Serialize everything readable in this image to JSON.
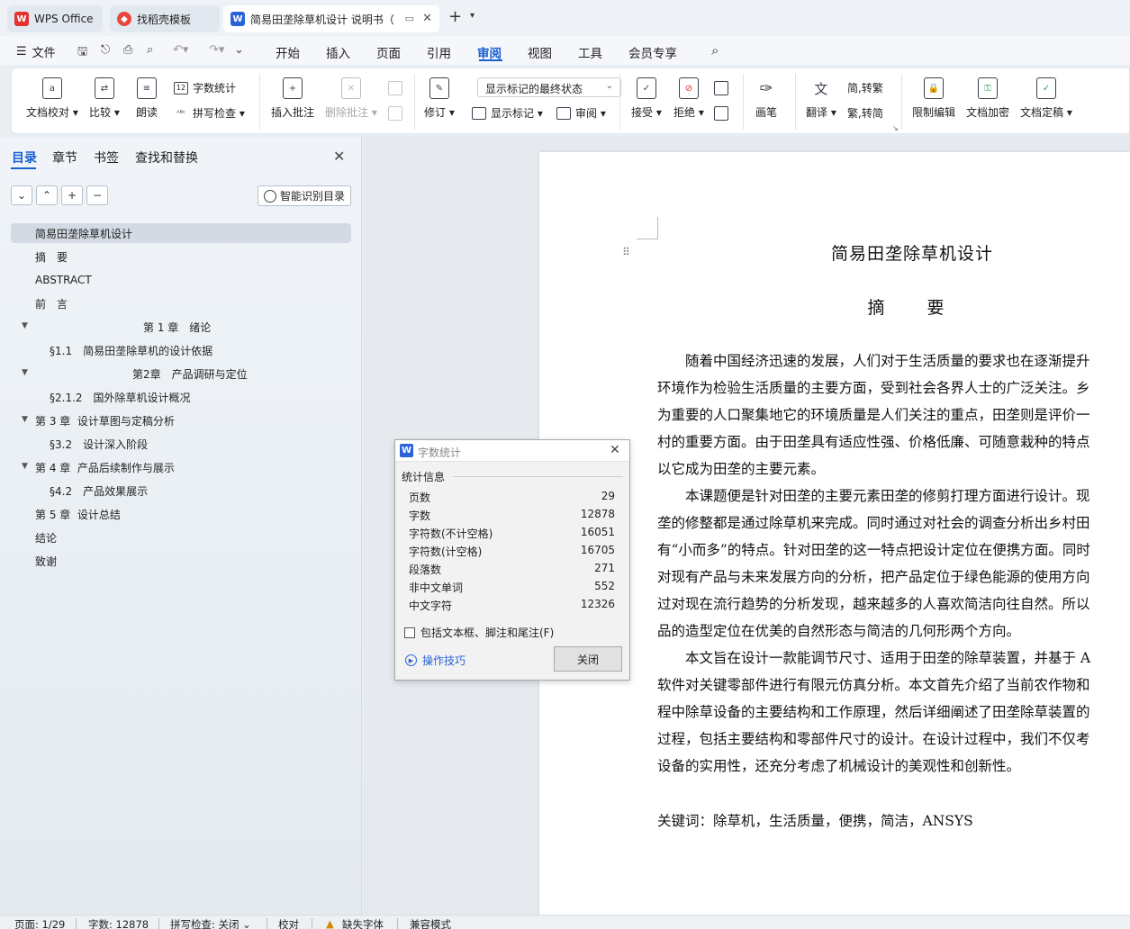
{
  "tabs": {
    "wps": "WPS Office",
    "templates": "找稻壳模板",
    "document": "简易田垄除草机设计 说明书（"
  },
  "menubar": {
    "file": "文件",
    "items": [
      "开始",
      "插入",
      "页面",
      "引用",
      "审阅",
      "视图",
      "工具",
      "会员专享"
    ],
    "active": "审阅"
  },
  "ribbon": {
    "proofread": "文档校对",
    "compare": "比较",
    "read_aloud": "朗读",
    "word_count": "字数统计",
    "spell_check": "拼写检查",
    "insert_comment": "插入批注",
    "delete_comment": "删除批注",
    "track_changes": "修订",
    "markup_state": "显示标记的最终状态",
    "show_markup": "显示标记",
    "review_pane": "审阅",
    "accept": "接受",
    "reject": "拒绝",
    "ink": "画笔",
    "translate": "翻译",
    "to_traditional": "简,转繁",
    "to_simplified": "繁,转简",
    "restrict_editing": "限制编辑",
    "encrypt": "文档加密",
    "finalize": "文档定稿"
  },
  "panel": {
    "tabs": [
      "目录",
      "章节",
      "书签",
      "查找和替换"
    ],
    "active_tab": "目录",
    "smart_toc": "智能识别目录",
    "toc": [
      {
        "label": "简易田垄除草机设计"
      },
      {
        "label": "摘　要"
      },
      {
        "label": "ABSTRACT"
      },
      {
        "label": "前　言"
      },
      {
        "label": "第 1 章　绪论"
      },
      {
        "label": "§1.1　简易田垄除草机的设计依据"
      },
      {
        "label": "第2章　产品调研与定位"
      },
      {
        "label": "§2.1.2　国外除草机设计概况"
      },
      {
        "label": "第 3 章  设计草图与定稿分析"
      },
      {
        "label": "§3.2　设计深入阶段"
      },
      {
        "label": "第 4 章  产品后续制作与展示"
      },
      {
        "label": "§4.2　产品效果展示"
      },
      {
        "label": "第 5 章  设计总结"
      },
      {
        "label": "结论"
      },
      {
        "label": "致谢"
      }
    ]
  },
  "document": {
    "title": "简易田垄除草机设计",
    "abstract_heading": "摘　要",
    "lines": [
      "　　随着中国经济迅速的发展，人们对于生活质量的要求也在逐渐提升",
      "环境作为检验生活质量的主要方面，受到社会各界人士的广泛关注。乡",
      "为重要的人口聚集地它的环境质量是人们关注的重点，田垄则是评价一",
      "村的重要方面。由于田垄具有适应性强、价格低廉、可随意栽种的特点",
      "以它成为田垄的主要元素。",
      "　　本课题便是针对田垄的主要元素田垄的修剪打理方面进行设计。现",
      "垄的修整都是通过除草机来完成。同时通过对社会的调查分析出乡村田",
      "有“小而多”的特点。针对田垄的这一特点把设计定位在便携方面。同时",
      "对现有产品与未来发展方向的分析，把产品定位于绿色能源的使用方向",
      "过对现在流行趋势的分析发现，越来越多的人喜欢简洁向往自然。所以",
      "品的造型定位在优美的自然形态与简洁的几何形两个方向。",
      "　　本文旨在设计一款能调节尺寸、适用于田垄的除草装置，并基于 A",
      "软件对关键零部件进行有限元仿真分析。本文首先介绍了当前农作物和",
      "程中除草设备的主要结构和工作原理，然后详细阐述了田垄除草装置的",
      "过程，包括主要结构和零部件尺寸的设计。在设计过程中，我们不仅考",
      "设备的实用性，还充分考虑了机械设计的美观性和创新性。"
    ],
    "keywords": "关键词：除草机，生活质量，便携，简洁，ANSYS"
  },
  "dialog": {
    "title": "字数统计",
    "group": "统计信息",
    "stats": [
      {
        "label": "页数",
        "value": "29"
      },
      {
        "label": "字数",
        "value": "12878"
      },
      {
        "label": "字符数(不计空格)",
        "value": "16051"
      },
      {
        "label": "字符数(计空格)",
        "value": "16705"
      },
      {
        "label": "段落数",
        "value": "271"
      },
      {
        "label": "非中文单词",
        "value": "552"
      },
      {
        "label": "中文字符",
        "value": "12326"
      }
    ],
    "include_label": "包括文本框、脚注和尾注(F)",
    "tips": "操作技巧",
    "close": "关闭"
  },
  "statusbar": {
    "page": "页面: 1/29",
    "words": "字数: 12878",
    "spell": "拼写检查: 关闭",
    "proof": "校对",
    "missing_font": "缺失字体",
    "compat": "兼容模式"
  }
}
